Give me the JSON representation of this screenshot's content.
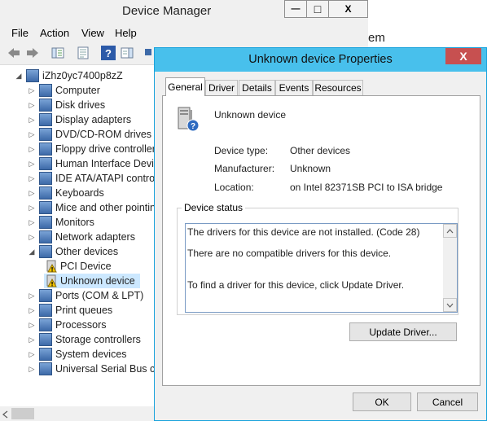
{
  "device_manager": {
    "title": "Device Manager",
    "controls": {
      "minimize": "—",
      "maximize": "□",
      "close": "X"
    },
    "menu": [
      "File",
      "Action",
      "View",
      "Help"
    ],
    "tree": {
      "root": "iZhz0yc7400p8zZ",
      "items": [
        {
          "label": "Computer",
          "icon": "computer-icon"
        },
        {
          "label": "Disk drives",
          "icon": "disk-drive-icon"
        },
        {
          "label": "Display adapters",
          "icon": "display-adapter-icon"
        },
        {
          "label": "DVD/CD-ROM drives",
          "icon": "dvd-drive-icon"
        },
        {
          "label": "Floppy drive controller",
          "icon": "floppy-controller-icon"
        },
        {
          "label": "Human Interface Devic",
          "icon": "hid-icon"
        },
        {
          "label": "IDE ATA/ATAPI contro",
          "icon": "ide-controller-icon"
        },
        {
          "label": "Keyboards",
          "icon": "keyboard-icon"
        },
        {
          "label": "Mice and other pointin",
          "icon": "mouse-icon"
        },
        {
          "label": "Monitors",
          "icon": "monitor-icon"
        },
        {
          "label": "Network adapters",
          "icon": "network-adapter-icon"
        },
        {
          "label": "Other devices",
          "icon": "other-devices-icon"
        },
        {
          "label": "PCI Device",
          "icon": "warning-device-icon"
        },
        {
          "label": "Unknown device",
          "icon": "warning-device-icon"
        },
        {
          "label": "Ports (COM & LPT)",
          "icon": "port-icon"
        },
        {
          "label": "Print queues",
          "icon": "printer-icon"
        },
        {
          "label": "Processors",
          "icon": "processor-icon"
        },
        {
          "label": "Storage controllers",
          "icon": "storage-controller-icon"
        },
        {
          "label": "System devices",
          "icon": "system-device-icon"
        },
        {
          "label": "Universal Serial Bus co",
          "icon": "usb-icon"
        }
      ]
    },
    "background_text": "em"
  },
  "dialog": {
    "title": "Unknown device Properties",
    "close": "X",
    "tabs": [
      "General",
      "Driver",
      "Details",
      "Events",
      "Resources"
    ],
    "device_name": "Unknown device",
    "fields": [
      {
        "label": "Device type:",
        "value": "Other devices"
      },
      {
        "label": "Manufacturer:",
        "value": "Unknown"
      },
      {
        "label": "Location:",
        "value": "on Intel 82371SB PCI to ISA bridge"
      }
    ],
    "status_group": "Device status",
    "status_lines": [
      "The drivers for this device are not installed. (Code 28)",
      "There are no compatible drivers for this device.",
      "To find a driver for this device, click Update Driver."
    ],
    "update_button": "Update Driver...",
    "ok_button": "OK",
    "cancel_button": "Cancel"
  },
  "colors": {
    "dialog_title_bg": "#48c0ec",
    "close_button": "#c75050",
    "selection": "#cce8ff"
  }
}
